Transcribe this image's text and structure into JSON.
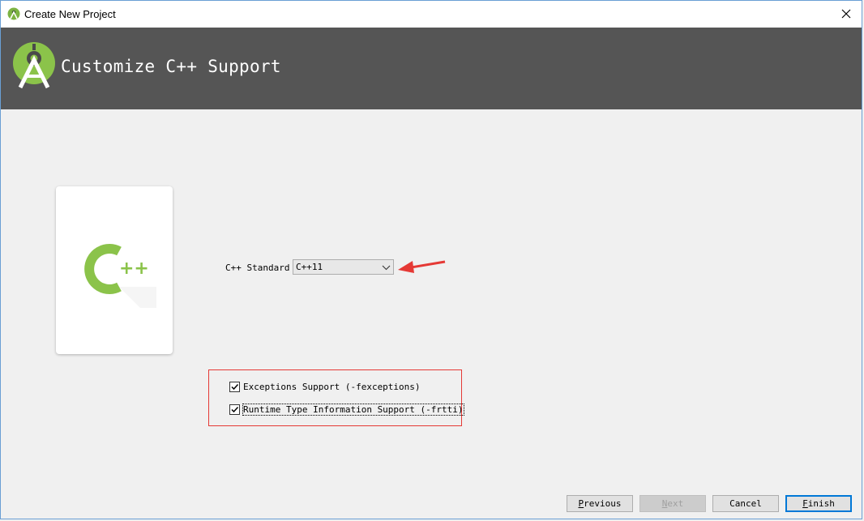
{
  "window": {
    "title": "Create New Project",
    "close_symbol": "✕"
  },
  "header": {
    "title": "Customize C++ Support",
    "logo_icon": "android-studio-icon"
  },
  "card": {
    "icon": "cpp-icon",
    "icon_text": "++"
  },
  "cpp_standard": {
    "label": "C++ Standard",
    "selected": "C++11"
  },
  "options": {
    "exceptions": {
      "label": "Exceptions Support (-fexceptions)",
      "checked": true
    },
    "rtti": {
      "label": "Runtime Type Information Support (-frtti)",
      "checked": true
    }
  },
  "buttons": {
    "previous": {
      "mnemonic": "P",
      "rest": "revious"
    },
    "next": {
      "mnemonic": "N",
      "rest": "ext"
    },
    "cancel": {
      "label": "Cancel"
    },
    "finish": {
      "mnemonic": "F",
      "rest": "inish"
    }
  },
  "colors": {
    "header_bg": "#555555",
    "android_green": "#8bc34a",
    "annotation_red": "#e53935",
    "default_button_border": "#0078d7"
  }
}
